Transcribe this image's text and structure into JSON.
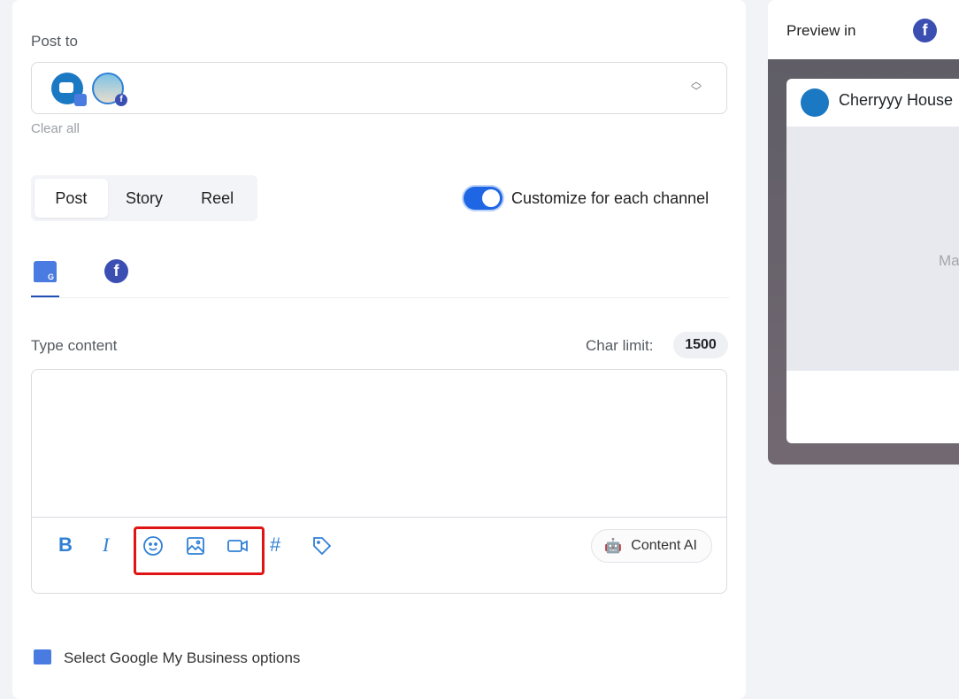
{
  "post_to": {
    "label": "Post to",
    "clear_all": "Clear all",
    "accounts": [
      {
        "type": "google-my-business"
      },
      {
        "type": "facebook"
      }
    ]
  },
  "post_types": {
    "items": [
      "Post",
      "Story",
      "Reel"
    ],
    "selected": "Post"
  },
  "customize": {
    "label": "Customize for each channel",
    "enabled": true
  },
  "channel_tabs": [
    {
      "icon": "google-my-business-icon",
      "active": true
    },
    {
      "icon": "facebook-icon",
      "active": false
    }
  ],
  "content": {
    "label": "Type content",
    "char_limit_label": "Char limit:",
    "char_limit": "1500",
    "value": ""
  },
  "toolbar": {
    "bold": "B",
    "italic": "I",
    "hashtag": "#",
    "content_ai": "Content AI"
  },
  "gmb_options": "Select Google My Business options",
  "preview": {
    "label": "Preview in",
    "account_name": "Cherryyy House",
    "media_placeholder": "Ma"
  },
  "colors": {
    "accent": "#1f66e5",
    "facebook": "#3b4fb3",
    "highlight": "#e01414",
    "icon_blue": "#2f80d6"
  }
}
